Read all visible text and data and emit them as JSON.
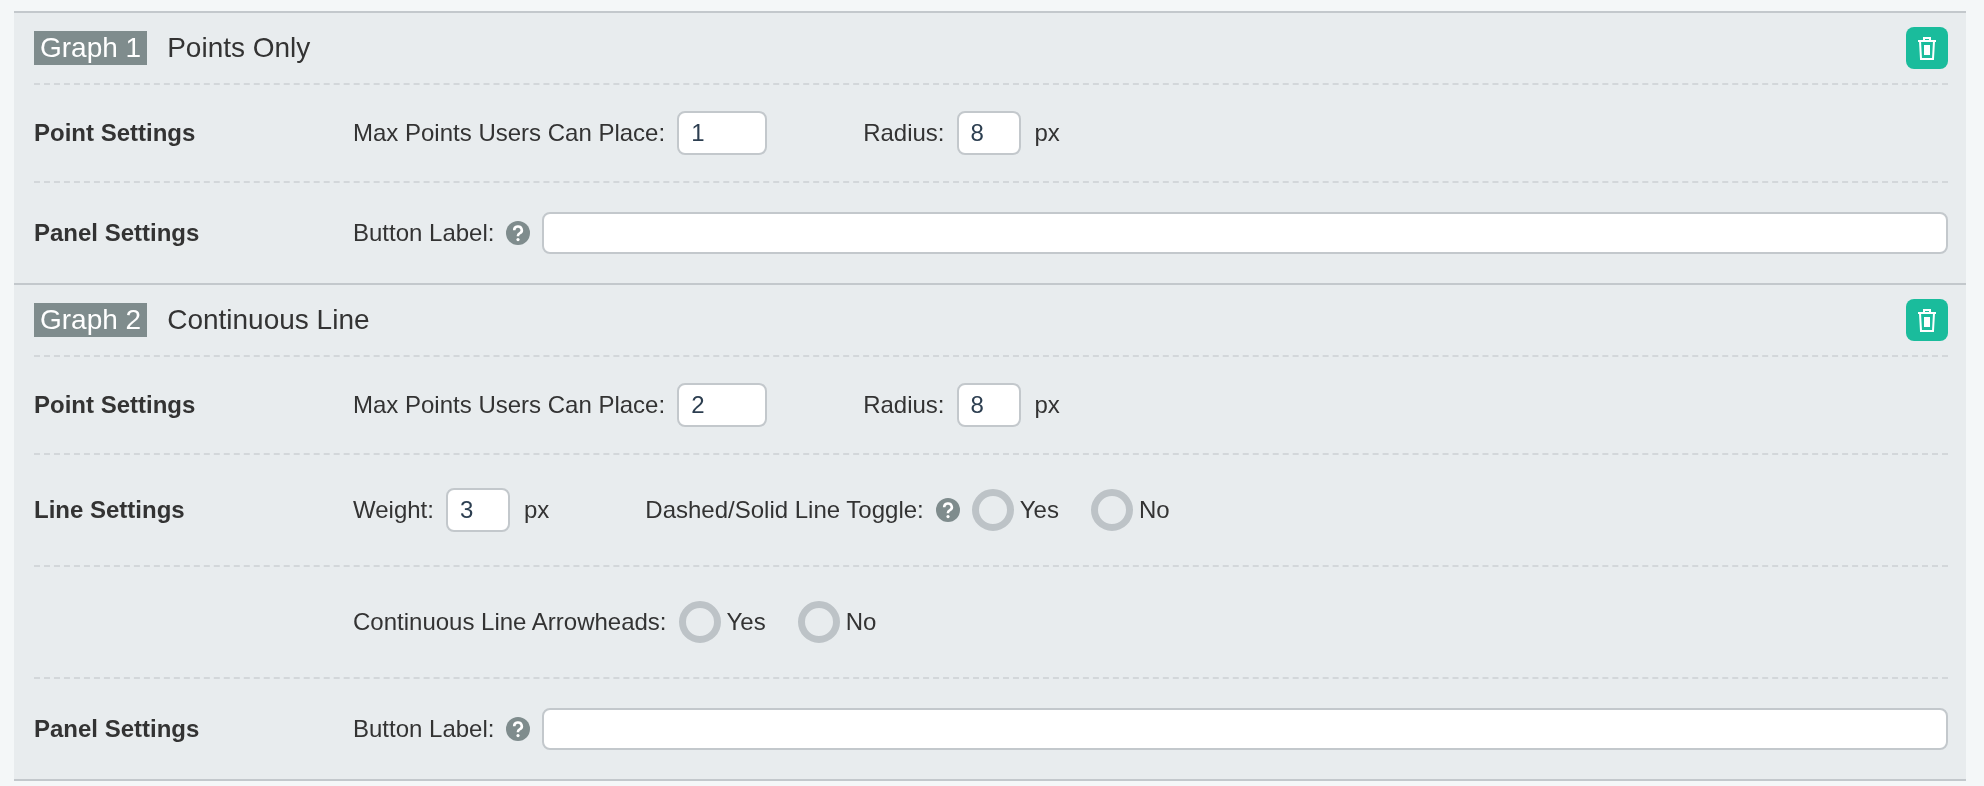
{
  "graphs": [
    {
      "tag": "Graph 1",
      "title": "Points Only",
      "rows": [
        {
          "heading": "Point Settings",
          "items": [
            {
              "kind": "number",
              "label": "Max Points Users Can Place:",
              "value": "1"
            },
            {
              "kind": "number",
              "label": "Radius:",
              "value": "8",
              "unit": "px"
            }
          ]
        },
        {
          "heading": "Panel Settings",
          "items": [
            {
              "kind": "text",
              "label": "Button Label:",
              "help": true
            }
          ]
        }
      ]
    },
    {
      "tag": "Graph 2",
      "title": "Continuous Line",
      "rows": [
        {
          "heading": "Point Settings",
          "items": [
            {
              "kind": "number",
              "label": "Max Points Users Can Place:",
              "value": "2"
            },
            {
              "kind": "number",
              "label": "Radius:",
              "value": "8",
              "unit": "px"
            }
          ]
        },
        {
          "heading": "Line Settings",
          "items": [
            {
              "kind": "number",
              "label": "Weight:",
              "value": "3",
              "unit": "px"
            },
            {
              "kind": "radio",
              "label": "Dashed/Solid Line Toggle:",
              "help": true,
              "options": [
                {
                  "label": "Yes",
                  "selected": false
                },
                {
                  "label": "No",
                  "selected": false
                }
              ]
            }
          ]
        },
        {
          "items": [
            {
              "kind": "radio",
              "label": "Continuous Line Arrowheads:",
              "help": false,
              "options": [
                {
                  "label": "Yes",
                  "selected": false
                },
                {
                  "label": "No",
                  "selected": false
                }
              ]
            }
          ]
        },
        {
          "heading": "Panel Settings",
          "items": [
            {
              "kind": "text",
              "label": "Button Label:",
              "help": true
            }
          ]
        }
      ]
    }
  ]
}
